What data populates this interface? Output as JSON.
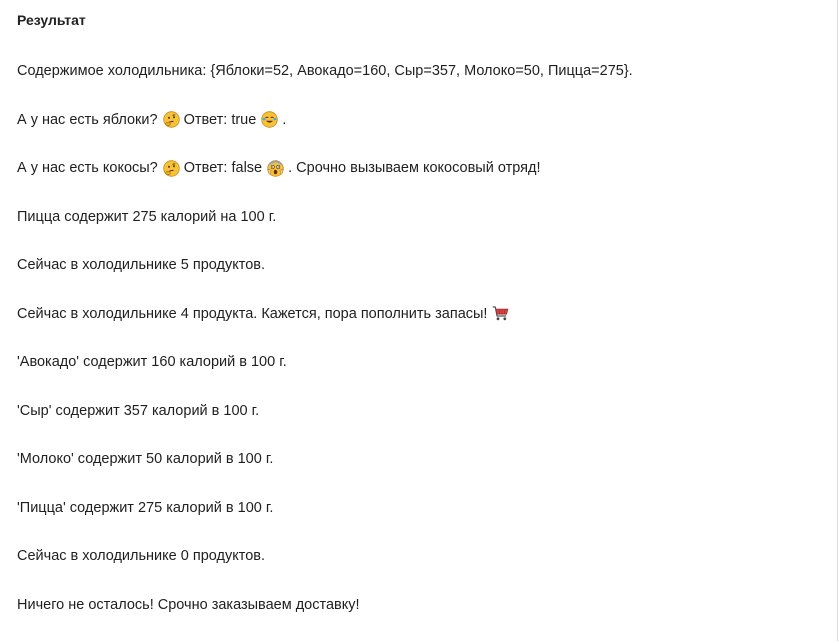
{
  "panel": {
    "title": "Результат"
  },
  "output": {
    "line1": "Содержимое холодильника: {Яблоки=52, Авокадо=160, Сыр=357, Молоко=50, Пицца=275}.",
    "line2": {
      "question": "А у нас есть яблоки?",
      "answer": "Ответ: true",
      "tail": "."
    },
    "line3": {
      "question": "А у нас есть кокосы?",
      "answer": "Ответ: false",
      "tail": ". Срочно вызываем кокосовый отряд!"
    },
    "line4": "Пицца содержит 275 калорий на 100 г.",
    "line5": "Сейчас в холодильнике 5 продуктов.",
    "line6": {
      "text": "Сейчас в холодильнике 4 продукта. Кажется, пора пополнить запасы!"
    },
    "line7": "'Авокадо' содержит 160 калорий в 100 г.",
    "line8": "'Сыр' содержит 357 калорий в 100 г.",
    "line9": "'Молоко' содержит 50 калорий в 100 г.",
    "line10": "'Пицца' содержит 275 калорий в 100 г.",
    "line11": "Сейчас в холодильнике 0 продуктов.",
    "line12": "Ничего не осталось! Срочно заказываем доставку!"
  },
  "icons": {
    "thinking": "thinking-face-emoji",
    "smiling": "smiling-face-emoji",
    "screaming": "screaming-face-emoji",
    "cart": "shopping-cart-emoji"
  },
  "colors": {
    "text": "#1f1f1f",
    "emoji_yellow": "#f7c23a",
    "emoji_outline": "#c98a12"
  }
}
